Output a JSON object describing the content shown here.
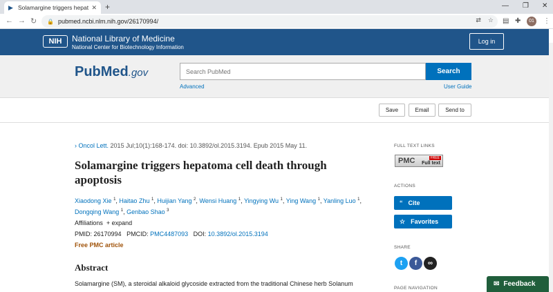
{
  "browser": {
    "tab_title": "Solamargine triggers hepatom",
    "url": "pubmed.ncbi.nlm.nih.gov/26170994/",
    "profile": "01"
  },
  "nih": {
    "logo": "NIH",
    "title": "National Library of Medicine",
    "subtitle": "National Center for Biotechnology Information",
    "login": "Log in"
  },
  "pubmed": {
    "logo_main": "PubMed",
    "logo_suffix": ".gov",
    "search_placeholder": "Search PubMed",
    "search_button": "Search",
    "advanced": "Advanced",
    "user_guide": "User Guide"
  },
  "actions_bar": {
    "save": "Save",
    "email": "Email",
    "send_to": "Send to"
  },
  "article": {
    "journal": "Oncol Lett.",
    "citation": " 2015 Jul;10(1):168-174. doi: 10.3892/ol.2015.3194. Epub 2015 May 11.",
    "title": "Solamargine triggers hepatoma cell death through apoptosis",
    "authors": [
      {
        "name": "Xiaodong Xie",
        "sup": "1"
      },
      {
        "name": "Haitao Zhu",
        "sup": "1"
      },
      {
        "name": "Huijian Yang",
        "sup": "2"
      },
      {
        "name": "Wensi Huang",
        "sup": "1"
      },
      {
        "name": "Yingying Wu",
        "sup": "1"
      },
      {
        "name": "Ying Wang",
        "sup": "1"
      },
      {
        "name": "Yanling Luo",
        "sup": "1"
      },
      {
        "name": "Dongqing Wang",
        "sup": "1"
      },
      {
        "name": "Genbao Shao",
        "sup": "3"
      }
    ],
    "affiliations": "Affiliations",
    "expand": "+ expand",
    "pmid_label": "PMID: ",
    "pmid": "26170994",
    "pmcid_label": "PMCID: ",
    "pmcid": "PMC4487093",
    "doi_label": "DOI: ",
    "doi": "10.3892/ol.2015.3194",
    "free_pmc": "Free PMC article",
    "abstract_heading": "Abstract",
    "abstract_text": "Solamargine (SM), a steroidal alkaloid glycoside extracted from the traditional Chinese herb Solanum"
  },
  "sidebar": {
    "full_text_links": "FULL TEXT LINKS",
    "pmc_badge": "PMC",
    "pmc_free": "FREE",
    "pmc_full": "Full text",
    "actions": "ACTIONS",
    "cite": "Cite",
    "favorites": "Favorites",
    "share": "SHARE",
    "page_navigation": "PAGE NAVIGATION"
  },
  "feedback": "Feedback",
  "colors": {
    "nih_blue": "#20558a",
    "link_blue": "#0071bc",
    "feedback_green": "#205e3b",
    "free_pmc": "#a0530a"
  }
}
